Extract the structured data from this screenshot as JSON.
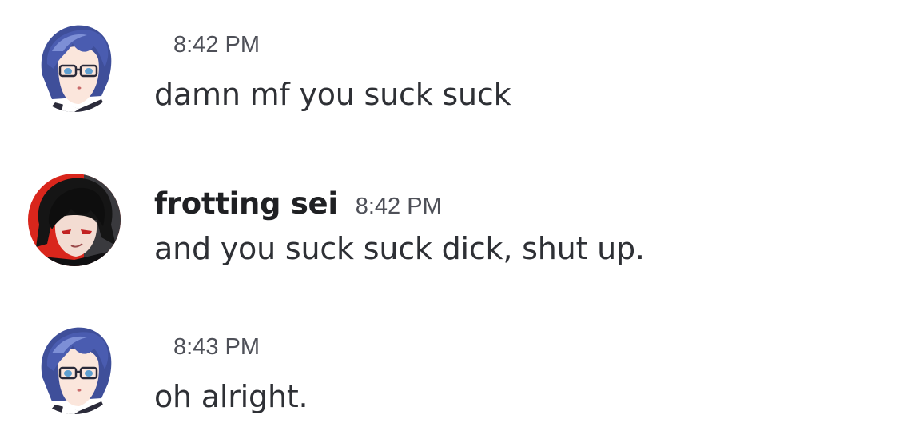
{
  "messages": [
    {
      "author": "",
      "timestamp": "8:42 PM",
      "text": "damn mf you suck suck",
      "avatar_icon": "blue-haired-glasses-avatar"
    },
    {
      "author": "frotting sei",
      "timestamp": "8:42 PM",
      "text": "and you suck suck dick, shut up.",
      "avatar_icon": "dark-haired-red-avatar"
    },
    {
      "author": "",
      "timestamp": "8:43 PM",
      "text": "oh alright.",
      "avatar_icon": "blue-haired-glasses-avatar"
    }
  ],
  "colors": {
    "background": "#ffffff",
    "message_text": "#2e3035",
    "username": "#1f2023",
    "timestamp": "#4e5058",
    "avatar_red": "#d9261c"
  }
}
